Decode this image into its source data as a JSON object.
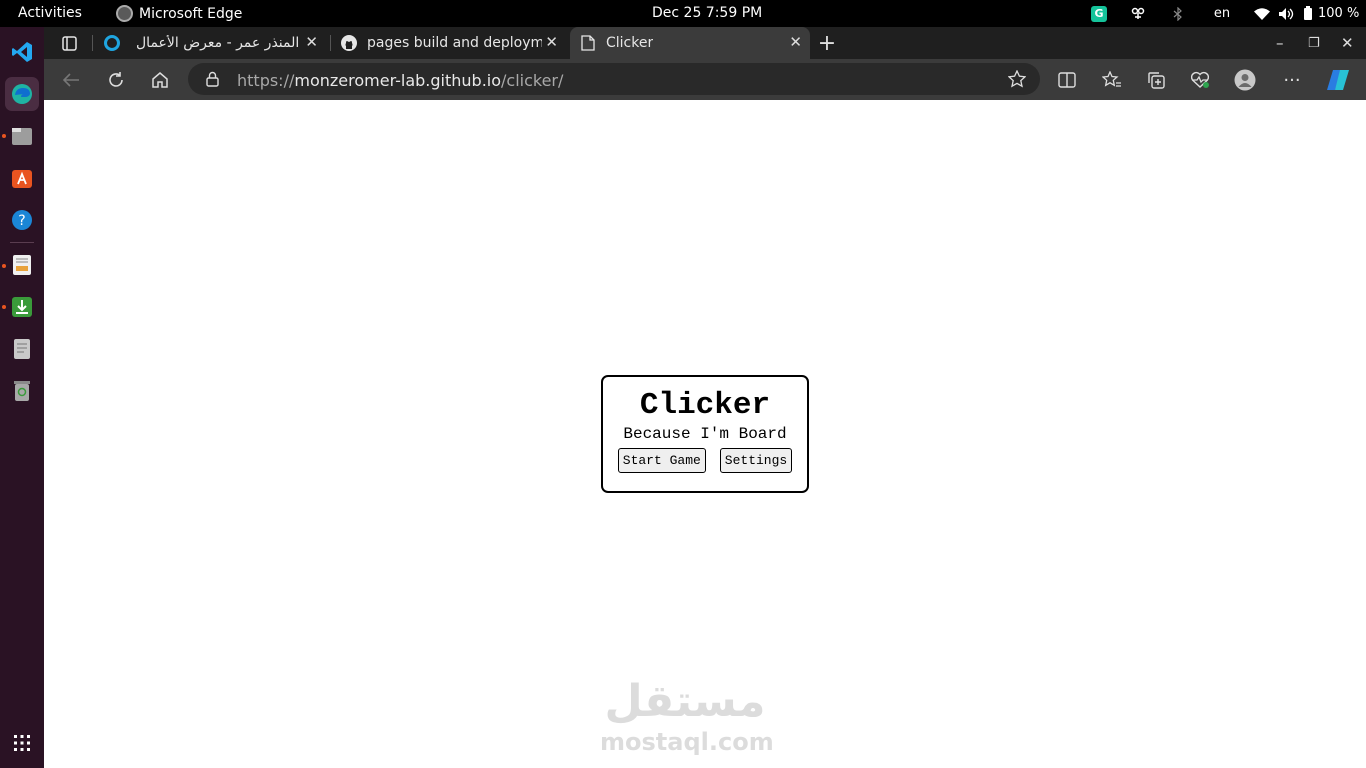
{
  "topbar": {
    "activities": "Activities",
    "app_name": "Microsoft Edge",
    "clock": "Dec 25   7:59 PM",
    "language": "en",
    "battery": "100 %"
  },
  "tabs": [
    {
      "title": "المنذر عمر - معرض الأعمال",
      "icon": "mostaql-icon"
    },
    {
      "title": "pages build and deployment",
      "icon": "github-icon"
    },
    {
      "title": "Clicker",
      "icon": "page-icon"
    }
  ],
  "address": {
    "url_prefix": "https://",
    "url_host": "monzeromer-lab.github.io",
    "url_path": "/clicker/"
  },
  "page": {
    "title": "Clicker",
    "subtitle": "Because I'm Board",
    "start_label": "Start Game",
    "settings_label": "Settings"
  },
  "watermark": {
    "arabic": "مستقل",
    "latin": "mostaql.com"
  },
  "colors": {
    "dock_bg": "#2a1224",
    "tab_active": "#3b3b3b",
    "tabstrip": "#1f1f1f",
    "accent_orange": "#e95420"
  }
}
